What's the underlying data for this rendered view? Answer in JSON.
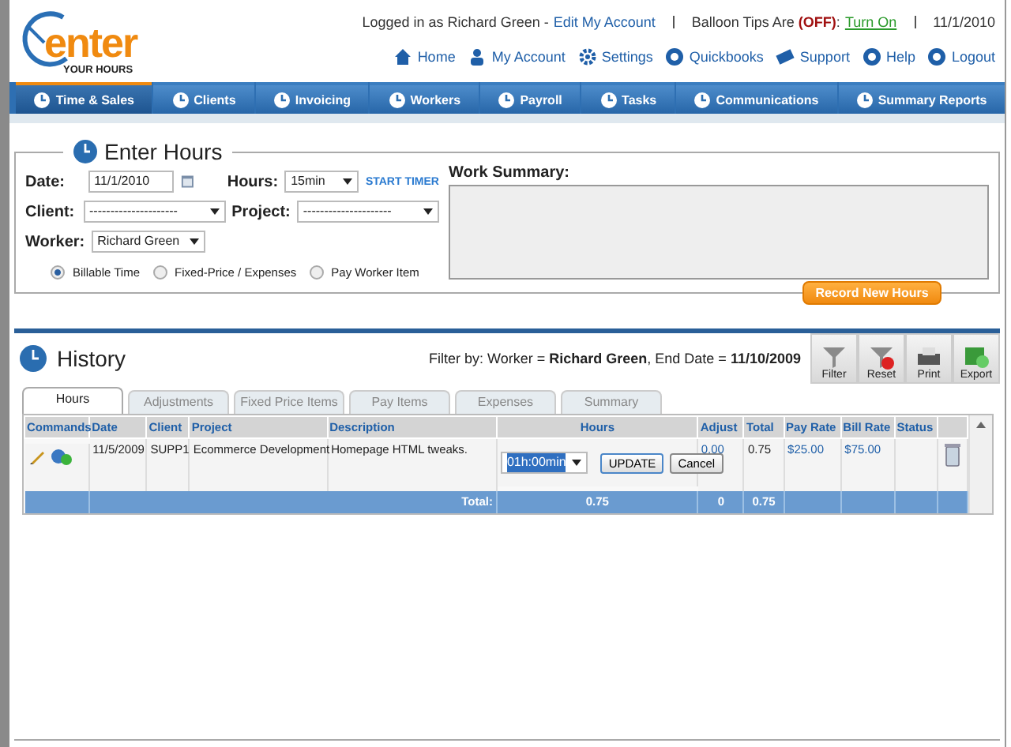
{
  "header": {
    "logo": {
      "word": "enter",
      "tagline": "YOUR HOURS"
    },
    "login_text": "Logged in as Richard Green -",
    "edit_account_link": "Edit My Account",
    "balloon_tips": "Balloon Tips Are **(OFF)**:",
    "turn_on_link": "Turn On",
    "date": "11/1/2010",
    "links": [
      {
        "label": "Home"
      },
      {
        "label": "My Account"
      },
      {
        "label": "Settings"
      },
      {
        "label": "Quickbooks"
      },
      {
        "label": "Support"
      },
      {
        "label": "Help"
      },
      {
        "label": "Logout"
      }
    ]
  },
  "nav": [
    {
      "label": "Time & Sales",
      "selected": true
    },
    {
      "label": "Clients",
      "selected": false
    },
    {
      "label": "Invoicing",
      "selected": false
    },
    {
      "label": "Workers",
      "selected": false
    },
    {
      "label": "Payroll",
      "selected": false
    },
    {
      "label": "Tasks",
      "selected": false
    },
    {
      "label": "Communications",
      "selected": false
    },
    {
      "label": "Summary Reports",
      "selected": false
    }
  ],
  "enter_hours": {
    "title": "Enter Hours",
    "date_label": "Date:",
    "date": "11/1/2010",
    "hours_label": "Hours:",
    "hours": "15min",
    "start_timer": "START TIMER",
    "client_label": "Client:",
    "client": "---------------------",
    "project_label": "Project:",
    "project": "---------------------",
    "worker_label": "Worker:",
    "worker": "Richard Green",
    "types": [
      {
        "label": "Billable Time",
        "selected": true
      },
      {
        "label": "Fixed-Price / Expenses",
        "selected": false
      },
      {
        "label": "Pay Worker Item",
        "selected": false
      }
    ],
    "work_summary_label": "Work Summary:",
    "record_button": "Record New Hours"
  },
  "history": {
    "title": "History",
    "filter_text": "Filter by: Worker = **Richard Green**, End Date = **11/10/2009**",
    "tools": [
      {
        "label": "Filter"
      },
      {
        "label": "Reset"
      },
      {
        "label": "Print"
      },
      {
        "label": "Export"
      }
    ],
    "tabs": [
      {
        "label": "Hours",
        "selected": true
      },
      {
        "label": "Adjustments",
        "selected": false
      },
      {
        "label": "Fixed Price Items",
        "selected": false
      },
      {
        "label": "Pay Items",
        "selected": false
      },
      {
        "label": "Expenses",
        "selected": false
      },
      {
        "label": "Summary",
        "selected": false
      }
    ],
    "table": {
      "columns": [
        "Commands",
        "Date",
        "Client",
        "Project",
        "Description",
        "Hours",
        "Adjust",
        "Total",
        "Pay Rate",
        "Bill Rate",
        "Status"
      ],
      "rows": [
        {
          "date": "11/5/2009",
          "client": "SUPP1",
          "project": "Ecommerce Development",
          "description": "Homepage HTML tweaks.",
          "hours": "01h:00min",
          "update_button": "UPDATE",
          "cancel_button": "Cancel",
          "adjust": "0.00",
          "total": "0.75",
          "pay_rate": "$25.00",
          "bill_rate": "$75.00"
        }
      ],
      "totals": {
        "label": "Total:",
        "hours": "0.75",
        "adjust": "0",
        "total": "0.75"
      }
    }
  }
}
